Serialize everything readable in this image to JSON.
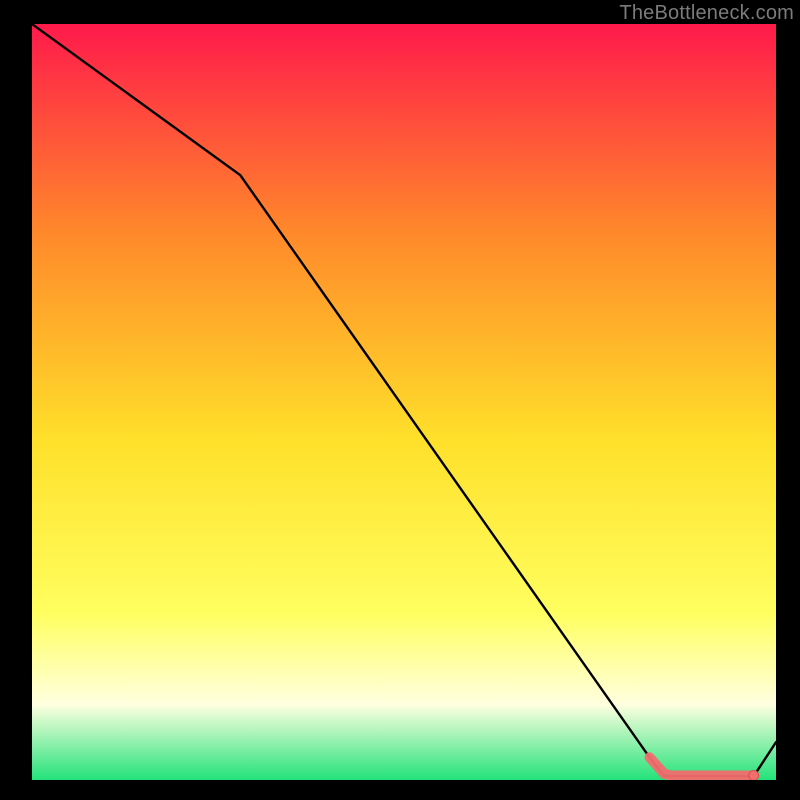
{
  "watermark": "TheBottleneck.com",
  "colors": {
    "gradient_top": "#ff1a4b",
    "gradient_mid_upper": "#ff8a2a",
    "gradient_mid": "#ffe02a",
    "gradient_mid_lower": "#ffff60",
    "gradient_pale": "#ffffe0",
    "gradient_green": "#23e27a",
    "line": "#000000",
    "marker_fill": "#f26d6d",
    "marker_stroke": "#d94f4f",
    "frame": "#000000"
  },
  "chart_data": {
    "type": "line",
    "title": "",
    "xlabel": "",
    "ylabel": "",
    "xlim": [
      0,
      100
    ],
    "ylim": [
      0,
      100
    ],
    "series": [
      {
        "name": "curve",
        "x": [
          0,
          28,
          83,
          85,
          97,
          100
        ],
        "y": [
          100,
          80,
          3,
          0.5,
          0.5,
          5
        ]
      }
    ],
    "markers": {
      "name": "highlight-segment",
      "x": [
        83,
        85,
        86,
        87,
        88,
        89,
        90,
        91,
        92,
        94,
        96,
        97
      ],
      "y": [
        3,
        0.8,
        0.6,
        0.6,
        0.6,
        0.6,
        0.6,
        0.6,
        0.6,
        0.6,
        0.6,
        0.6
      ]
    }
  }
}
